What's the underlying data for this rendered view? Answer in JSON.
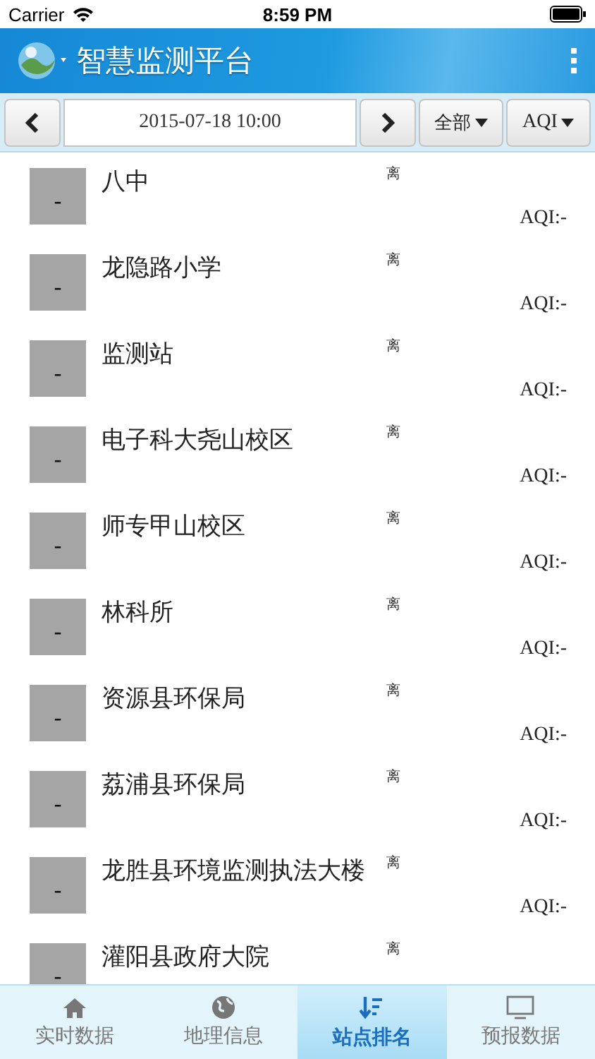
{
  "status_bar": {
    "carrier": "Carrier",
    "time": "8:59 PM"
  },
  "header": {
    "title": "智慧监测平台"
  },
  "toolbar": {
    "date": "2015-07-18 10:00",
    "filter": "全部",
    "metric": "AQI"
  },
  "stations": [
    {
      "badge": "-",
      "name": "八中",
      "note": "离",
      "aqi": "AQI:-"
    },
    {
      "badge": "-",
      "name": "龙隐路小学",
      "note": "离",
      "aqi": "AQI:-"
    },
    {
      "badge": "-",
      "name": "监测站",
      "note": "离",
      "aqi": "AQI:-"
    },
    {
      "badge": "-",
      "name": "电子科大尧山校区",
      "note": "离",
      "aqi": "AQI:-"
    },
    {
      "badge": "-",
      "name": "师专甲山校区",
      "note": "离",
      "aqi": "AQI:-"
    },
    {
      "badge": "-",
      "name": "林科所",
      "note": "离",
      "aqi": "AQI:-"
    },
    {
      "badge": "-",
      "name": "资源县环保局",
      "note": "离",
      "aqi": "AQI:-"
    },
    {
      "badge": "-",
      "name": "荔浦县环保局",
      "note": "离",
      "aqi": "AQI:-"
    },
    {
      "badge": "-",
      "name": "龙胜县环境监测执法大楼",
      "note": "离",
      "aqi": "AQI:-"
    },
    {
      "badge": "-",
      "name": "灌阳县政府大院",
      "note": "离"
    }
  ],
  "tabs": [
    {
      "label": "实时数据",
      "kind": "home",
      "selected": false
    },
    {
      "label": "地理信息",
      "kind": "globe",
      "selected": false
    },
    {
      "label": "站点排名",
      "kind": "sort",
      "selected": true
    },
    {
      "label": "预报数据",
      "kind": "monitor",
      "selected": false
    }
  ]
}
